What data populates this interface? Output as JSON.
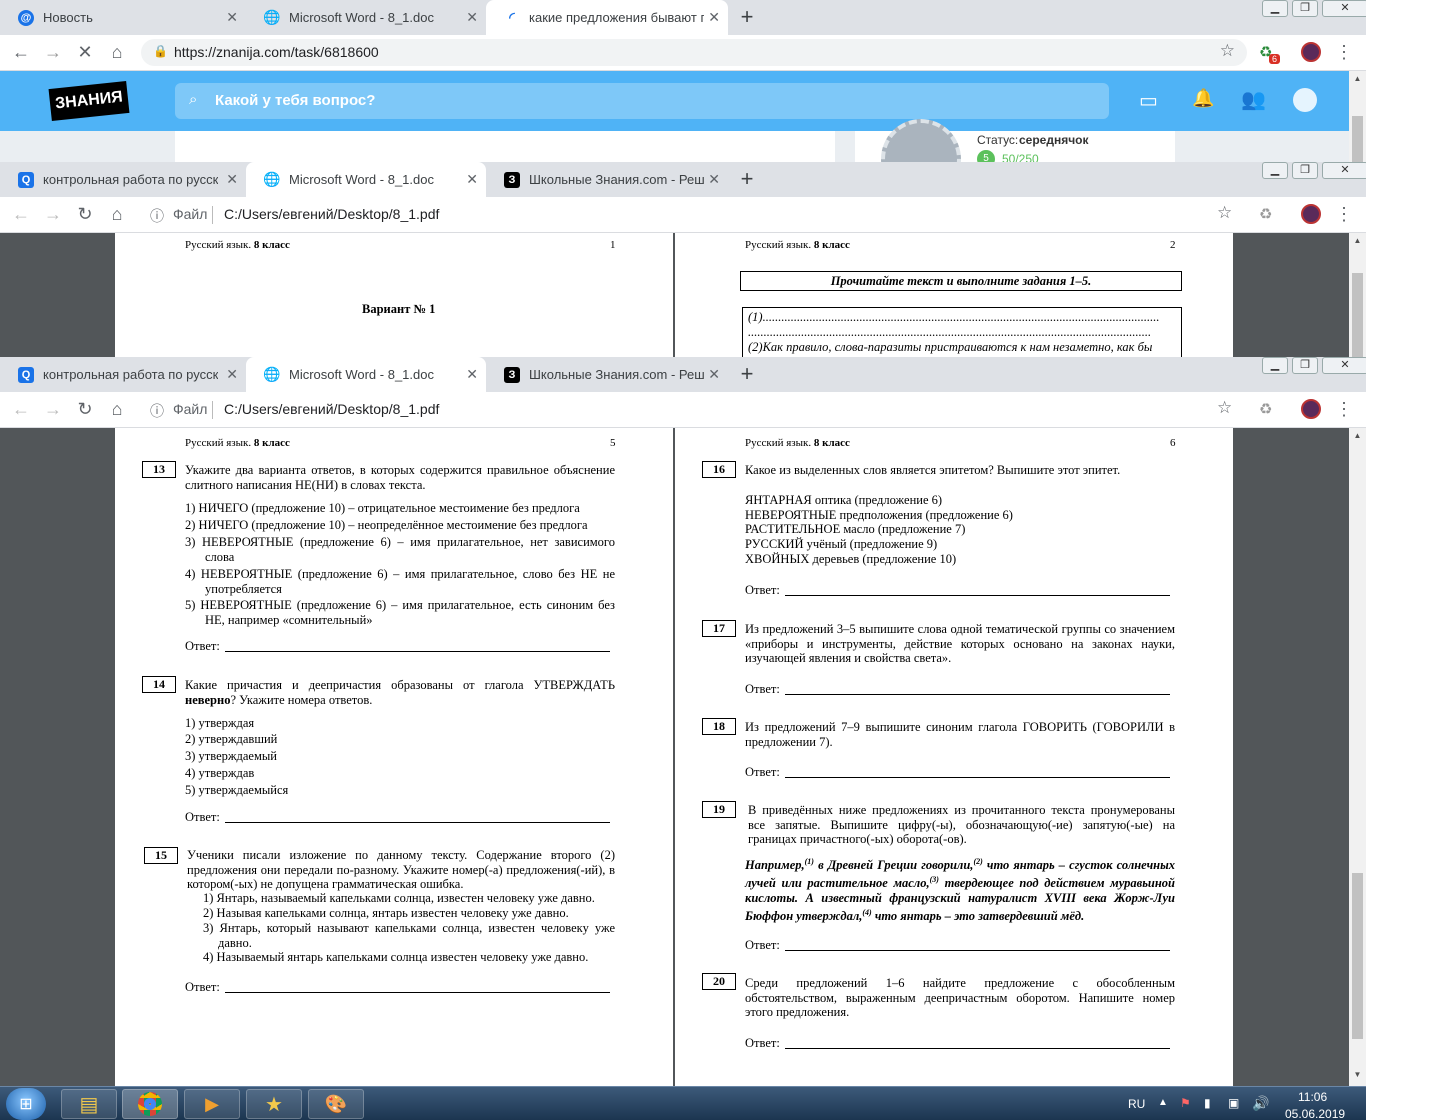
{
  "win1": {
    "tabs": [
      {
        "title": "Новость",
        "favicon": "@"
      },
      {
        "title": "Microsoft Word - 8_1.doc",
        "favicon": "globe"
      },
      {
        "title": "какие предложения бывают по",
        "favicon": "loading"
      }
    ],
    "url": "https://znanija.com/task/6818600",
    "ext_badge": "6",
    "site": {
      "logo": "ЗНАНИЯ",
      "search_placeholder": "Какой у тебя вопрос?",
      "status_label": "Статус:",
      "status_value": "середнячок",
      "points": "50/250"
    }
  },
  "win2": {
    "tabs": [
      {
        "title": "контрольная работа по русском",
        "favicon": "Q"
      },
      {
        "title": "Microsoft Word - 8_1.doc",
        "favicon": "globe"
      },
      {
        "title": "Школьные Знания.com - Решае",
        "favicon": "З"
      }
    ],
    "file_label": "Файл",
    "path": "C:/Users/евгений/Desktop/8_1.pdf",
    "left_page": {
      "header_prefix": "Русский язык.",
      "header_bold": "8 класс",
      "num": "1",
      "variant": "Вариант № 1"
    },
    "right_page": {
      "header_prefix": "Русский язык.",
      "header_bold": "8 класс",
      "num": "2",
      "instruction": "Прочитайте текст и выполните задания 1–5.",
      "line1": "(1)...............................................................................................................................",
      "line2": ".................................................................................................................................",
      "line3": "(2)Как правило, слова-паразиты пристраиваются к нам незаметно, как бы"
    }
  },
  "win3": {
    "tabs": [
      {
        "title": "контрольная работа по русском",
        "favicon": "Q"
      },
      {
        "title": "Microsoft Word - 8_1.doc",
        "favicon": "globe"
      },
      {
        "title": "Школьные Знания.com - Решае",
        "favicon": "З"
      }
    ],
    "file_label": "Файл",
    "path": "C:/Users/евгений/Desktop/8_1.pdf",
    "answer_label": "Ответ:",
    "left_page": {
      "header_prefix": "Русский язык.",
      "header_bold": "8 класс",
      "num": "5",
      "q13": {
        "num": "13",
        "text": "Укажите два варианта ответов, в которых содержится правильное объяснение слитного написания НЕ(НИ) в словах текста.",
        "options": [
          "1)  НИЧЕГО (предложение 10) – отрицательное местоимение без предлога",
          "2)  НИЧЕГО (предложение 10) – неопределённое местоимение без предлога",
          "3)  НЕВЕРОЯТНЫЕ (предложение 6) – имя прилагательное, нет зависимого слова",
          "4)  НЕВЕРОЯТНЫЕ (предложение 6) – имя прилагательное, слово без НЕ не употребляется",
          "5)  НЕВЕРОЯТНЫЕ (предложение 6) – имя прилагательное, есть синоним без НЕ, например «сомнительный»"
        ]
      },
      "q14": {
        "num": "14",
        "text_a": "Какие причастия и деепричастия образованы от глагола УТВЕРЖДАТЬ ",
        "text_bold": "неверно",
        "text_b": "? Укажите номера ответов.",
        "options": [
          "1)  утверждая",
          "2)  утверждавший",
          "3)  утверждаемый",
          "4)  утверждав",
          "5)  утверждаемыйся"
        ]
      },
      "q15": {
        "num": "15",
        "text": "Ученики писали изложение по данному тексту. Содержание второго (2) предложения они передали по-разному. Укажите номер(-а) предложения(-ий), в котором(-ых) не допущена грамматическая ошибка.",
        "options": [
          "1) Янтарь, называемый капельками солнца, известен человеку уже давно.",
          "2) Называя капельками солнца, янтарь известен человеку уже давно.",
          "3) Янтарь, который называют капельками солнца, известен человеку уже давно.",
          "4) Называемый янтарь капельками солнца известен человеку уже давно."
        ]
      }
    },
    "right_page": {
      "header_prefix": "Русский язык.",
      "header_bold": "8 класс",
      "num": "6",
      "q16": {
        "num": "16",
        "text": "Какое из выделенных слов является эпитетом? Выпишите этот эпитет.",
        "options": [
          "ЯНТАРНАЯ оптика (предложение 6)",
          "НЕВЕРОЯТНЫЕ предположения (предложение 6)",
          "РАСТИТЕЛЬНОЕ масло (предложение 7)",
          "РУССКИЙ учёный (предложение 9)",
          "ХВОЙНЫХ деревьев (предложение 10)"
        ]
      },
      "q17": {
        "num": "17",
        "text": "Из предложений 3–5 выпишите слова одной тематической группы со значением «приборы и инструменты, действие которых основано на законах науки, изучающей явления и свойства света»."
      },
      "q18": {
        "num": "18",
        "text": "Из предложений 7–9 выпишите синоним глагола ГОВОРИТЬ (ГОВОРИЛИ в предложении 7)."
      },
      "q19": {
        "num": "19",
        "text": "В приведённых ниже предложениях из прочитанного текста пронумерованы все запятые. Выпишите цифру(-ы), обозначающую(-ие) запятую(-ые) на границах причастного(-ых) оборота(-ов).",
        "example_parts": [
          "Например,",
          "(1)",
          " в Древней Греции говорили,",
          "(2)",
          " что янтарь – сгусток солнечных лучей или растительное масло,",
          "(3)",
          " твердеющее под действием муравьиной кислоты. А известный французский натуралист XVIII века Жорж-Луи Бюффон утверждал,",
          "(4)",
          " что янтарь – это затвердевший мёд."
        ]
      },
      "q20": {
        "num": "20",
        "text": "Среди предложений 1–6 найдите предложение с обособленным обстоятельством, выраженным деепричастным оборотом. Напишите номер этого предложения."
      }
    }
  },
  "taskbar": {
    "lang": "RU",
    "time": "11:06",
    "date": "05.06.2019"
  }
}
